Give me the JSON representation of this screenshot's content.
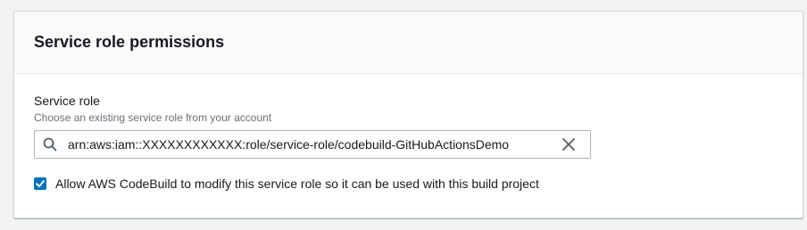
{
  "panel": {
    "title": "Service role permissions"
  },
  "service_role": {
    "label": "Service role",
    "description": "Choose an existing service role from your account",
    "value": "arn:aws:iam::XXXXXXXXXXXX:role/service-role/codebuild-GitHubActionsDemo",
    "search_icon": "search-icon",
    "clear_icon": "close-icon"
  },
  "allow_modify": {
    "checked": true,
    "label": "Allow AWS CodeBuild to modify this service role so it can be used with this build project"
  },
  "colors": {
    "checkbox": "#0073bb",
    "text": "#16191f",
    "muted": "#687078",
    "border": "#aab7b8"
  }
}
